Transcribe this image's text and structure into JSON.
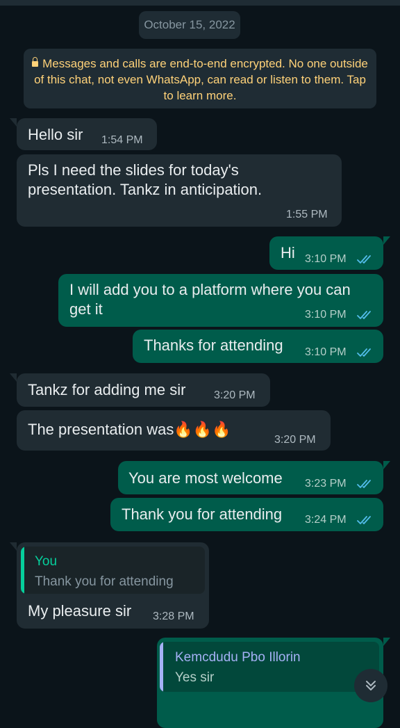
{
  "date_chip": "October 15, 2022",
  "encryption_notice": "Messages and calls are end-to-end encrypted. No one outside of this chat, not even WhatsApp, can read or listen to them. Tap to learn more.",
  "messages": [
    {
      "text": "Hello sir",
      "time": "1:54 PM"
    },
    {
      "text": "Pls I need the slides for today's presentation. Tankz in anticipation.",
      "time": "1:55 PM"
    },
    {
      "text": "Hi",
      "time": "3:10 PM"
    },
    {
      "text": "I will add you to a platform where you can get it",
      "time": "3:10 PM"
    },
    {
      "text": "Thanks for attending",
      "time": "3:10 PM"
    },
    {
      "text": "Tankz for adding me sir",
      "time": "3:20 PM"
    },
    {
      "text": "The presentation was",
      "emoji": "🔥🔥🔥",
      "time": "3:20 PM"
    },
    {
      "text": "You are most welcome",
      "time": "3:23 PM"
    },
    {
      "text": "Thank you for attending",
      "time": "3:24 PM"
    },
    {
      "text": "My pleasure sir",
      "time": "3:28 PM",
      "quote_name": "You",
      "quote_text": "Thank you for attending"
    },
    {
      "text": "",
      "time": "",
      "quote_name": "Kemcdudu Pbo Illorin",
      "quote_text": "Yes sir"
    }
  ],
  "colors": {
    "background": "#0b141a",
    "incoming": "#202c33",
    "outgoing": "#005c4b",
    "read_ticks": "#53bdeb",
    "encryption_text": "#ffd279",
    "quote_you": "#06cf9c",
    "quote_contact": "#a5b1f5"
  },
  "icons": {
    "lock": "lock-icon",
    "ticks": "double-check-icon",
    "scroll": "chevrons-down-icon"
  }
}
